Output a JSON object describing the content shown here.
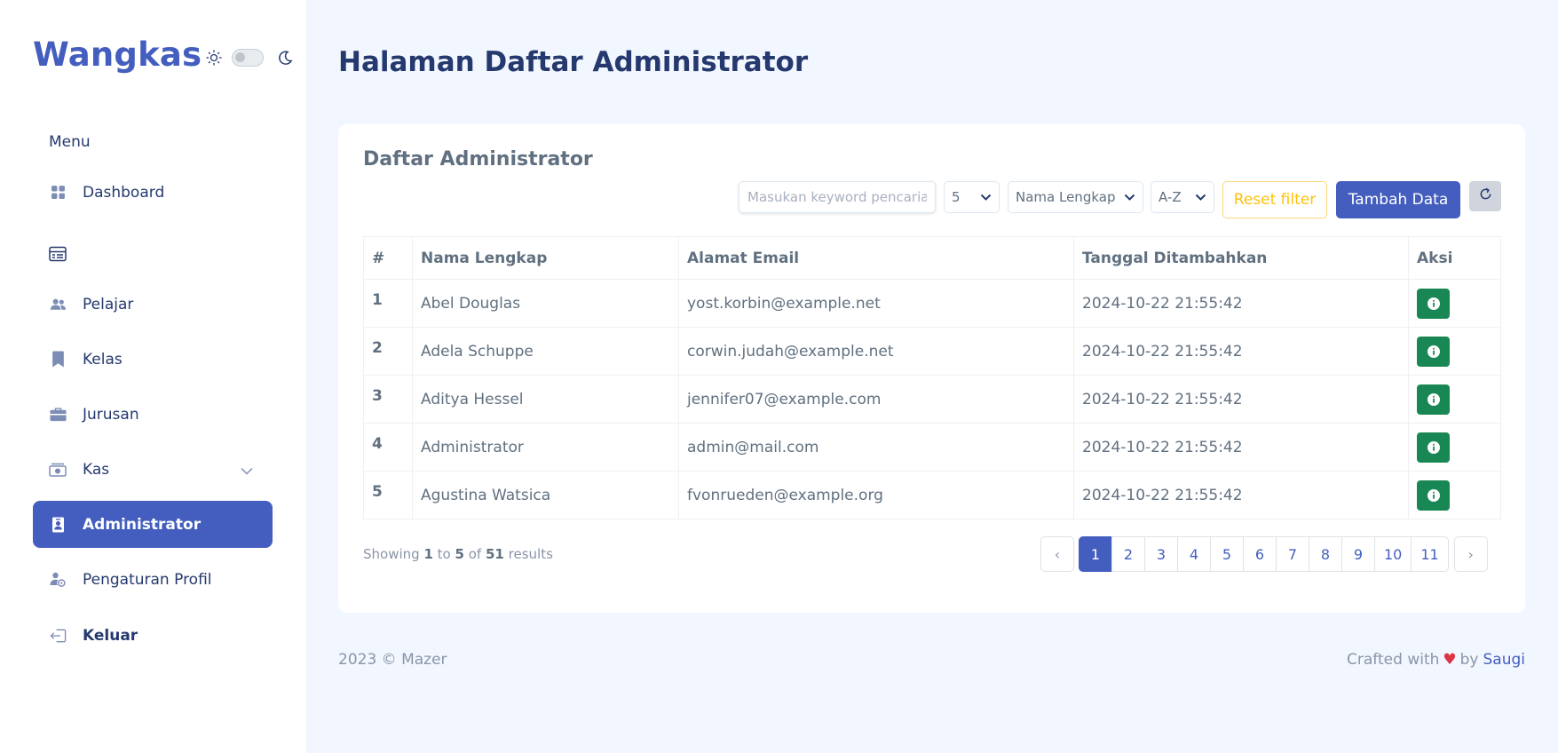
{
  "brand": "Wangkas",
  "sidebar": {
    "menu_title": "Menu",
    "items": [
      {
        "label": "Dashboard",
        "icon": "grid-icon"
      },
      {
        "label": "",
        "icon": "card-list-icon"
      },
      {
        "label": "Pelajar",
        "icon": "people-icon"
      },
      {
        "label": "Kelas",
        "icon": "bookmark-icon"
      },
      {
        "label": "Jurusan",
        "icon": "briefcase-icon"
      },
      {
        "label": "Kas",
        "icon": "cash-icon"
      },
      {
        "label": "Administrator",
        "icon": "person-badge-icon"
      },
      {
        "label": "Pengaturan Profil",
        "icon": "person-gear-icon"
      },
      {
        "label": "Keluar",
        "icon": "logout-icon"
      }
    ]
  },
  "page": {
    "title": "Halaman Daftar Administrator"
  },
  "card": {
    "title": "Daftar Administrator",
    "search_placeholder": "Masukan keyword pencarian",
    "per_page": "5",
    "sort_field": "Nama Lengkap",
    "sort_order": "A-Z",
    "reset_label": "Reset filter",
    "add_label": "Tambah Data"
  },
  "table": {
    "headers": [
      "#",
      "Nama Lengkap",
      "Alamat Email",
      "Tanggal Ditambahkan",
      "Aksi"
    ],
    "rows": [
      {
        "no": "1",
        "name": "Abel Douglas",
        "email": "yost.korbin@example.net",
        "date": "2024-10-22 21:55:42"
      },
      {
        "no": "2",
        "name": "Adela Schuppe",
        "email": "corwin.judah@example.net",
        "date": "2024-10-22 21:55:42"
      },
      {
        "no": "3",
        "name": "Aditya Hessel",
        "email": "jennifer07@example.com",
        "date": "2024-10-22 21:55:42"
      },
      {
        "no": "4",
        "name": "Administrator",
        "email": "admin@mail.com",
        "date": "2024-10-22 21:55:42"
      },
      {
        "no": "5",
        "name": "Agustina Watsica",
        "email": "fvonrueden@example.org",
        "date": "2024-10-22 21:55:42"
      }
    ]
  },
  "pagination": {
    "showing_prefix": "Showing",
    "from": "1",
    "to_word": "to",
    "to": "5",
    "of_word": "of",
    "total": "51",
    "results_word": "results",
    "prev": "‹",
    "next": "›",
    "pages": [
      "1",
      "2",
      "3",
      "4",
      "5",
      "6",
      "7",
      "8",
      "9",
      "10",
      "11"
    ],
    "current": "1"
  },
  "footer": {
    "copyright": "2023 © Mazer",
    "crafted_prefix": "Crafted with",
    "heart": "♥",
    "by_word": "by",
    "author": "Saugi"
  },
  "colors": {
    "primary": "#435ebe",
    "success": "#198754",
    "warning": "#ffc107",
    "background": "#f2f7ff"
  }
}
